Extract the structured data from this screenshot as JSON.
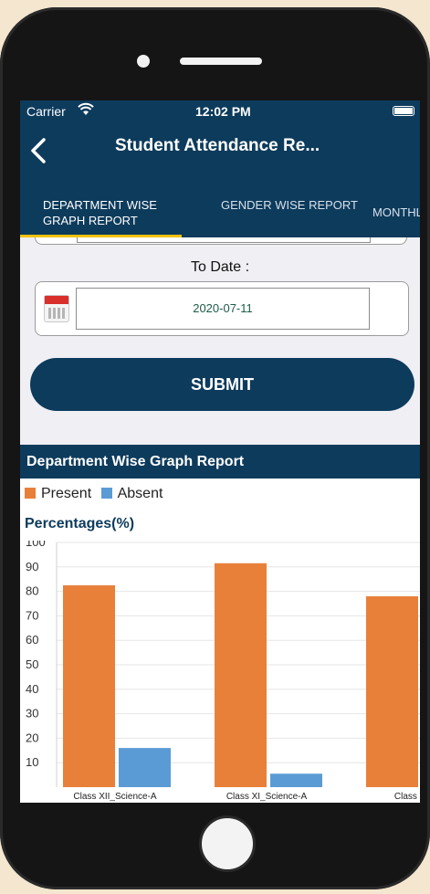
{
  "status_bar": {
    "carrier": "Carrier",
    "time": "12:02 PM"
  },
  "nav": {
    "back_icon": "chevron-left-icon",
    "title": "Student Attendance Re..."
  },
  "tabs": [
    {
      "label": "DEPARTMENT WISE GRAPH REPORT",
      "active": true
    },
    {
      "label": "GENDER WISE REPORT",
      "active": false
    },
    {
      "label": "MONTHL",
      "active": false
    }
  ],
  "form": {
    "to_date_label": "To Date :",
    "to_date_value": "2020-07-11",
    "submit_label": "SUBMIT"
  },
  "report": {
    "header": "Department Wise Graph Report"
  },
  "colors": {
    "primary": "#0d3b5c",
    "present": "#e8803a",
    "absent": "#5b9bd5",
    "tab_indicator": "#f4c20d"
  },
  "chart_data": {
    "type": "bar",
    "ylabel": "Percentages(%)",
    "ylim": [
      0,
      100
    ],
    "yticks": [
      10,
      20,
      30,
      40,
      50,
      60,
      70,
      80,
      90,
      100
    ],
    "ytick_labels": [
      "10",
      "20",
      "30",
      "40",
      "50",
      "60",
      "70",
      "80",
      "90",
      "100"
    ],
    "categories": [
      "Class XII_Science-A",
      "Class XI_Science-A",
      "Class XII_S"
    ],
    "series": [
      {
        "name": "Present",
        "values": [
          82.5,
          91.5,
          78
        ]
      },
      {
        "name": "Absent",
        "values": [
          16,
          5.5,
          null
        ]
      }
    ],
    "legend": "top-left"
  }
}
